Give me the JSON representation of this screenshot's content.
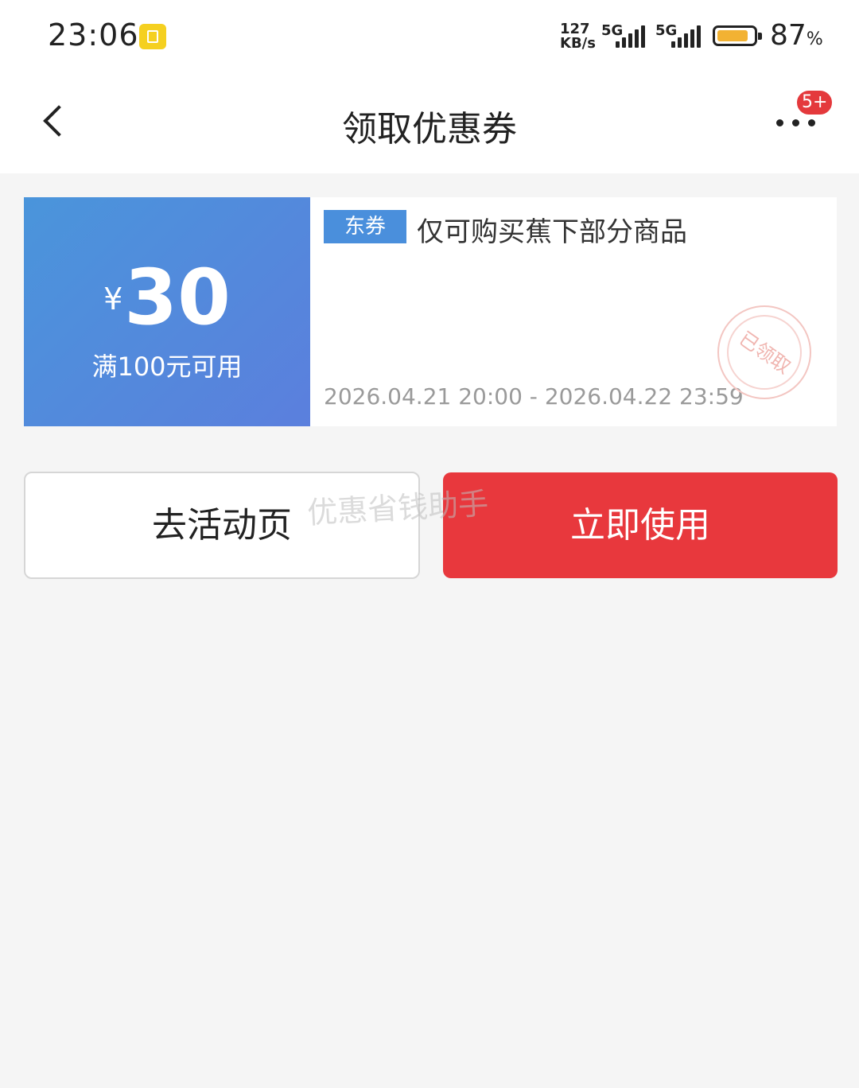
{
  "status_bar": {
    "time": "23:06",
    "network_speed_value": "127",
    "network_speed_unit": "KB/s",
    "sim1_label": "5G",
    "sim2_label": "5G",
    "battery_percent": "87",
    "battery_unit": "%",
    "battery_level": 0.87,
    "battery_color": "#f2b233"
  },
  "nav": {
    "title": "领取优惠券",
    "back_icon": "chevron-left-icon",
    "more_icon": "more-dots-icon",
    "badge": "5+"
  },
  "coupon": {
    "currency": "¥",
    "amount": "30",
    "threshold": "满100元可用",
    "tag": "东券",
    "description": "仅可购买蕉下部分商品",
    "validity": "2026.04.21 20:00 - 2026.04.22 23:59",
    "stamp": "已领取",
    "gradient_colors": [
      "#4a95db",
      "#5b7fdd"
    ]
  },
  "actions": {
    "secondary_label": "去活动页",
    "primary_label": "立即使用",
    "primary_color": "#e8383d"
  },
  "watermark": "优惠省钱助手"
}
